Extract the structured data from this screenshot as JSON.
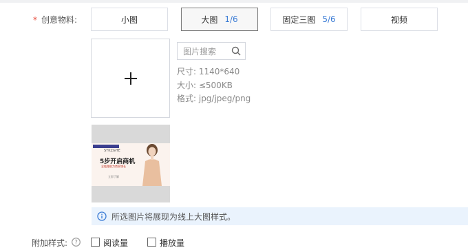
{
  "form": {
    "required_mark": "*",
    "creative_label": "创意物料:",
    "tabs": [
      {
        "label": "小图",
        "count": ""
      },
      {
        "label": "大图",
        "count": "1/6"
      },
      {
        "label": "固定三图",
        "count": "5/6"
      },
      {
        "label": "视频",
        "count": ""
      }
    ],
    "active_tab": "大图",
    "upload_icon": "plus-icon",
    "search": {
      "placeholder": "图片搜索",
      "icon": "search-icon"
    },
    "specs": [
      "尺寸: 1140*640",
      "大小: ≤500KB",
      "格式: jpg/jpeg/png"
    ],
    "notice": {
      "icon": "info-icon",
      "text": "所选图片将展现为线上大图样式。"
    },
    "extra_style_label": "附加样式:",
    "help_icon": "question-icon",
    "checkboxes": [
      {
        "label": "阅读量",
        "checked": false
      },
      {
        "label": "播放量",
        "checked": false
      }
    ]
  },
  "thumbnail": {
    "brand": "SYKZGHE",
    "line1": "5步开启商机",
    "line2": "全链路助力商家增长",
    "line3": "立即了解"
  },
  "colors": {
    "accent": "#3a7bd5",
    "required": "#e84a3c",
    "notice_bg": "#eaf3fd"
  }
}
